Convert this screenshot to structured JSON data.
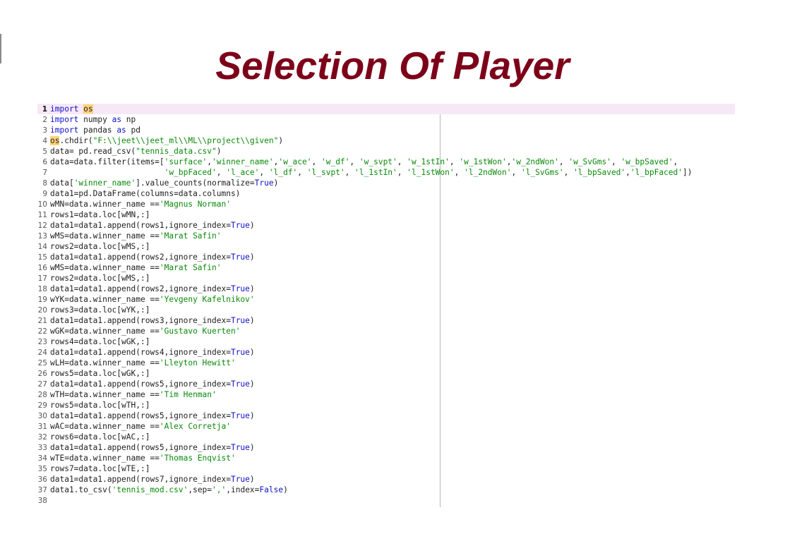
{
  "title": "Selection Of Player",
  "editor": {
    "current_line": 1,
    "lines": [
      {
        "n": "1",
        "tokens": [
          {
            "t": "import",
            "c": "kw"
          },
          {
            "t": " "
          },
          {
            "t": "os",
            "c": "hl"
          }
        ]
      },
      {
        "n": "2",
        "tokens": [
          {
            "t": "import",
            "c": "kw"
          },
          {
            "t": " numpy "
          },
          {
            "t": "as",
            "c": "kw"
          },
          {
            "t": " np"
          }
        ]
      },
      {
        "n": "3",
        "tokens": [
          {
            "t": "import",
            "c": "kw"
          },
          {
            "t": " pandas "
          },
          {
            "t": "as",
            "c": "kw"
          },
          {
            "t": " pd"
          }
        ]
      },
      {
        "n": "4",
        "tokens": [
          {
            "t": "os",
            "c": "hl"
          },
          {
            "t": ".chdir("
          },
          {
            "t": "\"F:\\\\jeet\\\\jeet_ml\\\\ML\\\\project\\\\given\"",
            "c": "str"
          },
          {
            "t": ")"
          }
        ]
      },
      {
        "n": "5",
        "tokens": [
          {
            "t": "data= pd.read_csv("
          },
          {
            "t": "\"tennis_data.csv\"",
            "c": "str"
          },
          {
            "t": ")"
          }
        ]
      },
      {
        "n": "6",
        "tokens": [
          {
            "t": "data=data.filter(items=["
          },
          {
            "t": "'surface'",
            "c": "str"
          },
          {
            "t": ","
          },
          {
            "t": "'winner_name'",
            "c": "str"
          },
          {
            "t": ","
          },
          {
            "t": "'w_ace'",
            "c": "str"
          },
          {
            "t": ", "
          },
          {
            "t": "'w_df'",
            "c": "str"
          },
          {
            "t": ", "
          },
          {
            "t": "'w_svpt'",
            "c": "str"
          },
          {
            "t": ", "
          },
          {
            "t": "'w_1stIn'",
            "c": "str"
          },
          {
            "t": ", "
          },
          {
            "t": "'w_1stWon'",
            "c": "str"
          },
          {
            "t": ","
          },
          {
            "t": "'w_2ndWon'",
            "c": "str"
          },
          {
            "t": ", "
          },
          {
            "t": "'w_SvGms'",
            "c": "str"
          },
          {
            "t": ", "
          },
          {
            "t": "'w_bpSaved'",
            "c": "str"
          },
          {
            "t": ","
          }
        ]
      },
      {
        "n": "7",
        "tokens": [
          {
            "t": "                        "
          },
          {
            "t": "'w_bpFaced'",
            "c": "str"
          },
          {
            "t": ", "
          },
          {
            "t": "'l_ace'",
            "c": "str"
          },
          {
            "t": ", "
          },
          {
            "t": "'l_df'",
            "c": "str"
          },
          {
            "t": ", "
          },
          {
            "t": "'l_svpt'",
            "c": "str"
          },
          {
            "t": ", "
          },
          {
            "t": "'l_1stIn'",
            "c": "str"
          },
          {
            "t": ", "
          },
          {
            "t": "'l_1stWon'",
            "c": "str"
          },
          {
            "t": ", "
          },
          {
            "t": "'l_2ndWon'",
            "c": "str"
          },
          {
            "t": ", "
          },
          {
            "t": "'l_SvGms'",
            "c": "str"
          },
          {
            "t": ", "
          },
          {
            "t": "'l_bpSaved'",
            "c": "str"
          },
          {
            "t": ","
          },
          {
            "t": "'l_bpFaced'",
            "c": "str"
          },
          {
            "t": "])"
          }
        ]
      },
      {
        "n": "8",
        "tokens": [
          {
            "t": "data["
          },
          {
            "t": "'winner_name'",
            "c": "str"
          },
          {
            "t": "].value_counts(normalize="
          },
          {
            "t": "True",
            "c": "bi"
          },
          {
            "t": ")"
          }
        ]
      },
      {
        "n": "9",
        "tokens": [
          {
            "t": "data1=pd.DataFrame(columns=data.columns)"
          }
        ]
      },
      {
        "n": "10",
        "tokens": [
          {
            "t": "wMN=data.winner_name =="
          },
          {
            "t": "'Magnus Norman'",
            "c": "str"
          }
        ]
      },
      {
        "n": "11",
        "tokens": [
          {
            "t": "rows1=data.loc[wMN,:]"
          }
        ]
      },
      {
        "n": "12",
        "tokens": [
          {
            "t": "data1=data1.append(rows1,ignore_index="
          },
          {
            "t": "True",
            "c": "bi"
          },
          {
            "t": ")"
          }
        ]
      },
      {
        "n": "13",
        "tokens": [
          {
            "t": "wMS=data.winner_name =="
          },
          {
            "t": "'Marat Safin'",
            "c": "str"
          }
        ]
      },
      {
        "n": "14",
        "tokens": [
          {
            "t": "rows2=data.loc[wMS,:]"
          }
        ]
      },
      {
        "n": "15",
        "tokens": [
          {
            "t": "data1=data1.append(rows2,ignore_index="
          },
          {
            "t": "True",
            "c": "bi"
          },
          {
            "t": ")"
          }
        ]
      },
      {
        "n": "16",
        "tokens": [
          {
            "t": "wMS=data.winner_name =="
          },
          {
            "t": "'Marat Safin'",
            "c": "str"
          }
        ]
      },
      {
        "n": "17",
        "tokens": [
          {
            "t": "rows2=data.loc[wMS,:]"
          }
        ]
      },
      {
        "n": "18",
        "tokens": [
          {
            "t": "data1=data1.append(rows2,ignore_index="
          },
          {
            "t": "True",
            "c": "bi"
          },
          {
            "t": ")"
          }
        ]
      },
      {
        "n": "19",
        "tokens": [
          {
            "t": "wYK=data.winner_name =="
          },
          {
            "t": "'Yevgeny Kafelnikov'",
            "c": "str"
          }
        ]
      },
      {
        "n": "20",
        "tokens": [
          {
            "t": "rows3=data.loc[wYK,:]"
          }
        ]
      },
      {
        "n": "21",
        "tokens": [
          {
            "t": "data1=data1.append(rows3,ignore_index="
          },
          {
            "t": "True",
            "c": "bi"
          },
          {
            "t": ")"
          }
        ]
      },
      {
        "n": "22",
        "tokens": [
          {
            "t": "wGK=data.winner_name =="
          },
          {
            "t": "'Gustavo Kuerten'",
            "c": "str"
          }
        ]
      },
      {
        "n": "23",
        "tokens": [
          {
            "t": "rows4=data.loc[wGK,:]"
          }
        ]
      },
      {
        "n": "24",
        "tokens": [
          {
            "t": "data1=data1.append(rows4,ignore_index="
          },
          {
            "t": "True",
            "c": "bi"
          },
          {
            "t": ")"
          }
        ]
      },
      {
        "n": "25",
        "tokens": [
          {
            "t": "wLH=data.winner_name =="
          },
          {
            "t": "'Lleyton Hewitt'",
            "c": "str"
          }
        ]
      },
      {
        "n": "26",
        "tokens": [
          {
            "t": "rows5=data.loc[wGK,:]"
          }
        ]
      },
      {
        "n": "27",
        "tokens": [
          {
            "t": "data1=data1.append(rows5,ignore_index="
          },
          {
            "t": "True",
            "c": "bi"
          },
          {
            "t": ")"
          }
        ]
      },
      {
        "n": "28",
        "tokens": [
          {
            "t": "wTH=data.winner_name =="
          },
          {
            "t": "'Tim Henman'",
            "c": "str"
          }
        ]
      },
      {
        "n": "29",
        "tokens": [
          {
            "t": "rows5=data.loc[wTH,:]"
          }
        ]
      },
      {
        "n": "30",
        "tokens": [
          {
            "t": "data1=data1.append(rows5,ignore_index="
          },
          {
            "t": "True",
            "c": "bi"
          },
          {
            "t": ")"
          }
        ]
      },
      {
        "n": "31",
        "tokens": [
          {
            "t": "wAC=data.winner_name =="
          },
          {
            "t": "'Alex Corretja'",
            "c": "str"
          }
        ]
      },
      {
        "n": "32",
        "tokens": [
          {
            "t": "rows6=data.loc[wAC,:]"
          }
        ]
      },
      {
        "n": "33",
        "tokens": [
          {
            "t": "data1=data1.append(rows5,ignore_index="
          },
          {
            "t": "True",
            "c": "bi"
          },
          {
            "t": ")"
          }
        ]
      },
      {
        "n": "34",
        "tokens": [
          {
            "t": "wTE=data.winner_name =="
          },
          {
            "t": "'Thomas Enqvist'",
            "c": "str"
          }
        ]
      },
      {
        "n": "35",
        "tokens": [
          {
            "t": "rows7=data.loc[wTE,:]"
          }
        ]
      },
      {
        "n": "36",
        "tokens": [
          {
            "t": "data1=data1.append(rows7,ignore_index="
          },
          {
            "t": "True",
            "c": "bi"
          },
          {
            "t": ")"
          }
        ]
      },
      {
        "n": "37",
        "tokens": [
          {
            "t": "data1.to_csv("
          },
          {
            "t": "'tennis_mod.csv'",
            "c": "str"
          },
          {
            "t": ",sep="
          },
          {
            "t": "','",
            "c": "str"
          },
          {
            "t": ",index="
          },
          {
            "t": "False",
            "c": "bi"
          },
          {
            "t": ")"
          }
        ]
      },
      {
        "n": "38",
        "tokens": []
      }
    ]
  }
}
